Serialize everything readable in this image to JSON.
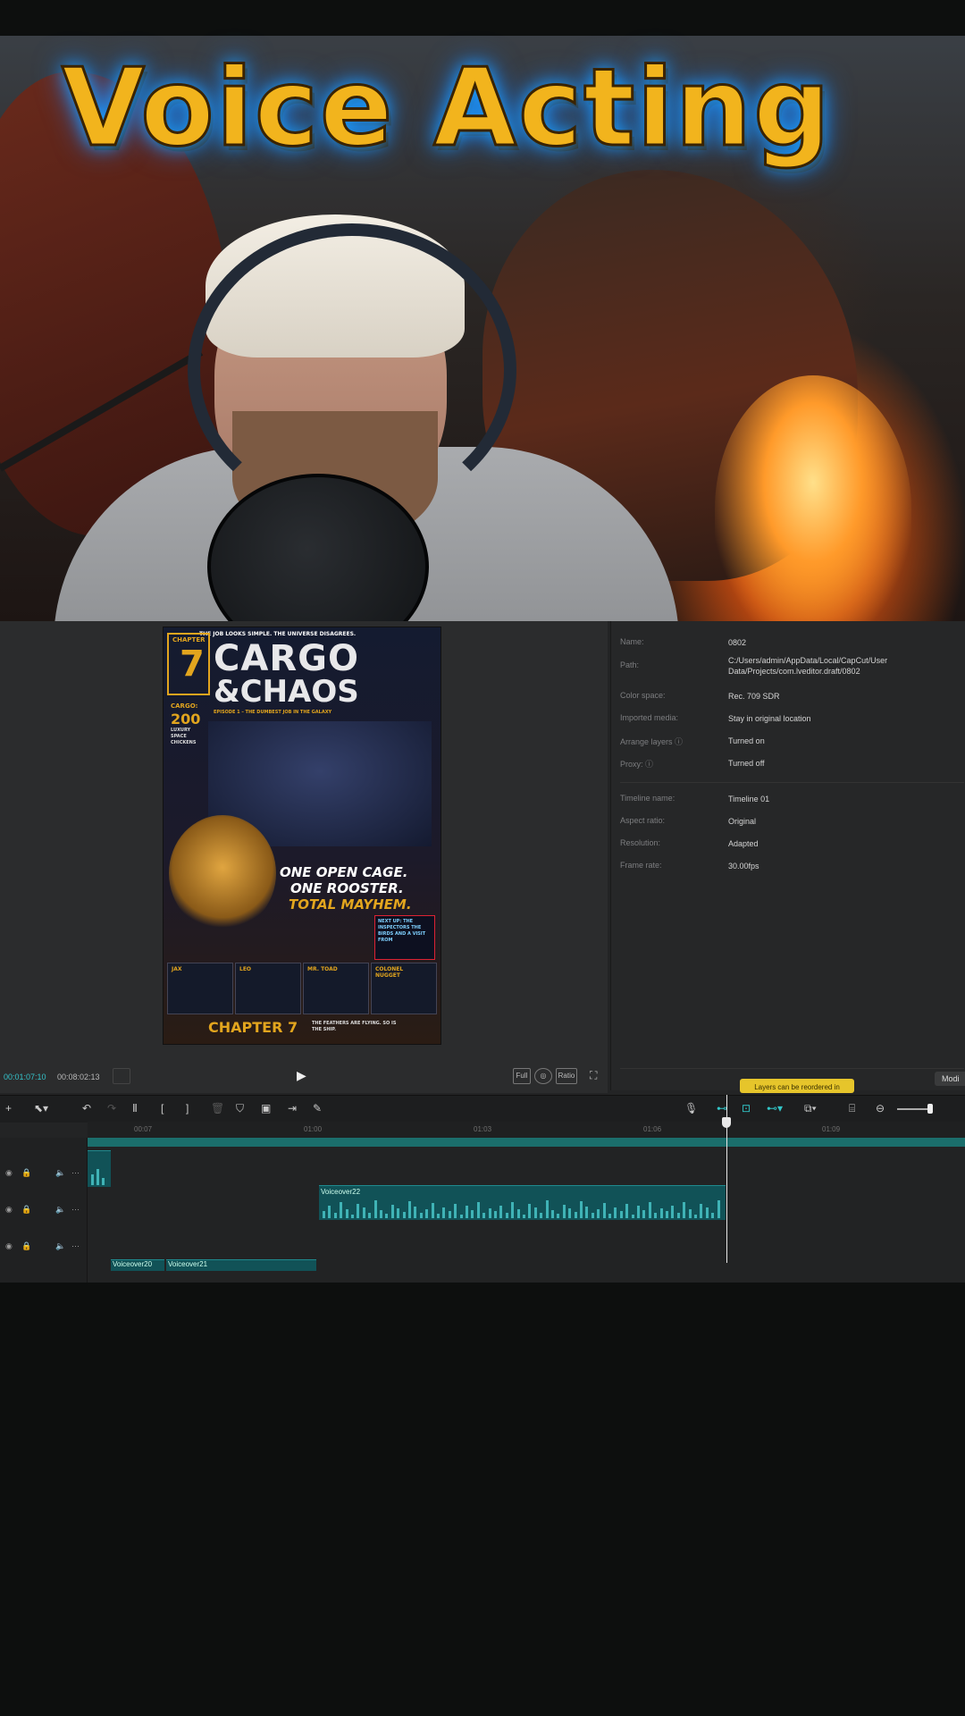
{
  "overlay": {
    "title": "Voice Acting"
  },
  "poster": {
    "tagline": "THE JOB LOOKS SIMPLE. THE UNIVERSE DISAGREES.",
    "chapter_small": "CHAPTER",
    "chapter_num": "7",
    "title_line1": "CARGO",
    "title_line2": "&CHAOS",
    "episode": "EPISODE 1 – THE DUMBEST JOB IN THE GALAXY",
    "cargo_label": "CARGO:",
    "cargo_count": "200",
    "cargo_desc": "LUXURY SPACE CHICKENS",
    "slogan1": "ONE OPEN CAGE.",
    "slogan2": "ONE ROOSTER.",
    "slogan3": "TOTAL MAYHEM.",
    "next_up": "NEXT UP: THE INSPECTORS THE BIRDS AND A VISIT FROM",
    "characters": [
      "JAX",
      "LEO",
      "MR. TOAD",
      "COLONEL NUGGET"
    ],
    "footer_chapter": "CHAPTER 7",
    "footer_tag": "THE FEATHERS ARE FLYING. SO IS THE SHIP."
  },
  "player": {
    "current_time": "00:01:07:10",
    "total_time": "00:08:02:13",
    "buttons": [
      "Full",
      "Ratio"
    ]
  },
  "details": {
    "rows": [
      {
        "label": "Name:",
        "value": "0802"
      },
      {
        "label": "Path:",
        "value": "C:/Users/admin/AppData/Local/CapCut/User Data/Projects/com.lveditor.draft/0802"
      },
      {
        "label": "Color space:",
        "value": "Rec. 709 SDR"
      },
      {
        "label": "Imported media:",
        "value": "Stay in original location"
      },
      {
        "label": "Arrange layers",
        "value": "Turned on"
      },
      {
        "label": "Proxy:",
        "value": "Turned off"
      },
      {
        "label": "Timeline name:",
        "value": "Timeline 01"
      },
      {
        "label": "Aspect ratio:",
        "value": "Original"
      },
      {
        "label": "Resolution:",
        "value": "Adapted"
      },
      {
        "label": "Frame rate:",
        "value": "30.00fps"
      }
    ],
    "tooltip": "Layers can be reordered in",
    "modify_button": "Modi"
  },
  "timeline": {
    "ruler_ticks": [
      "00:07",
      "01:00",
      "01:03",
      "01:06",
      "01:09"
    ],
    "clips": {
      "main_audio": "Voiceover22",
      "lower_a": "Voiceover20",
      "lower_b": "Voiceover21"
    }
  },
  "colors": {
    "accent_teal": "#32c6c8",
    "clip_teal": "#115257",
    "tooltip_yellow": "#e6c52b",
    "title_gold": "#f2b41d"
  }
}
